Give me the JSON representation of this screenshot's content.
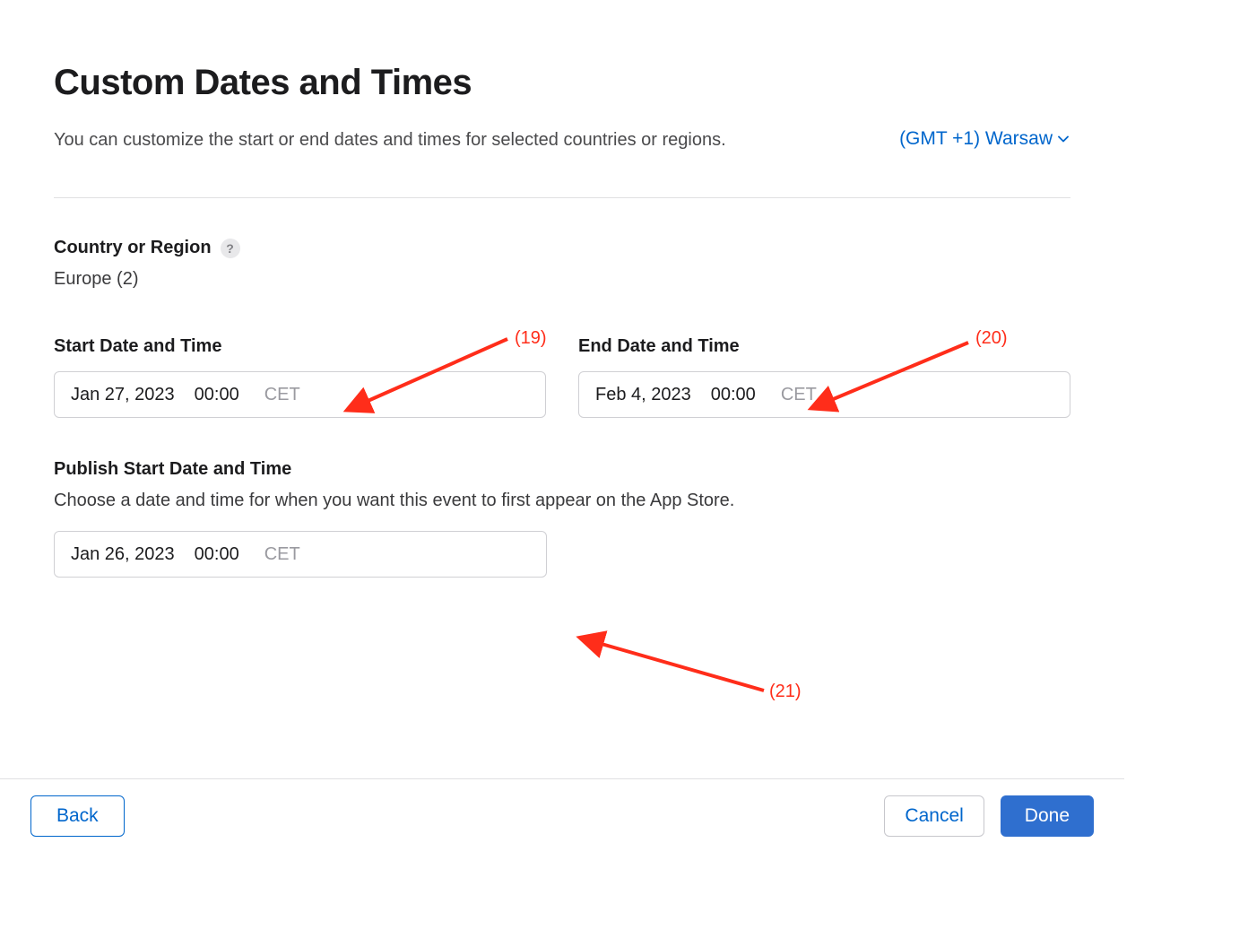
{
  "header": {
    "title": "Custom Dates and Times",
    "description": "You can customize the start or end dates and times for selected countries or regions.",
    "timezone_label": "(GMT +1) Warsaw"
  },
  "region": {
    "section_label": "Country or Region",
    "value": "Europe (2)"
  },
  "start": {
    "label": "Start Date and Time",
    "date": "Jan 27, 2023",
    "time": "00:00",
    "tz": "CET"
  },
  "end": {
    "label": "End Date and Time",
    "date": "Feb 4, 2023",
    "time": "00:00",
    "tz": "CET"
  },
  "publish": {
    "label": "Publish Start Date and Time",
    "description": "Choose a date and time for when you want this event to first appear on the App Store.",
    "date": "Jan 26, 2023",
    "time": "00:00",
    "tz": "CET"
  },
  "footer": {
    "back": "Back",
    "cancel": "Cancel",
    "done": "Done"
  },
  "annotations": {
    "a19": "(19)",
    "a20": "(20)",
    "a21": "(21)"
  }
}
